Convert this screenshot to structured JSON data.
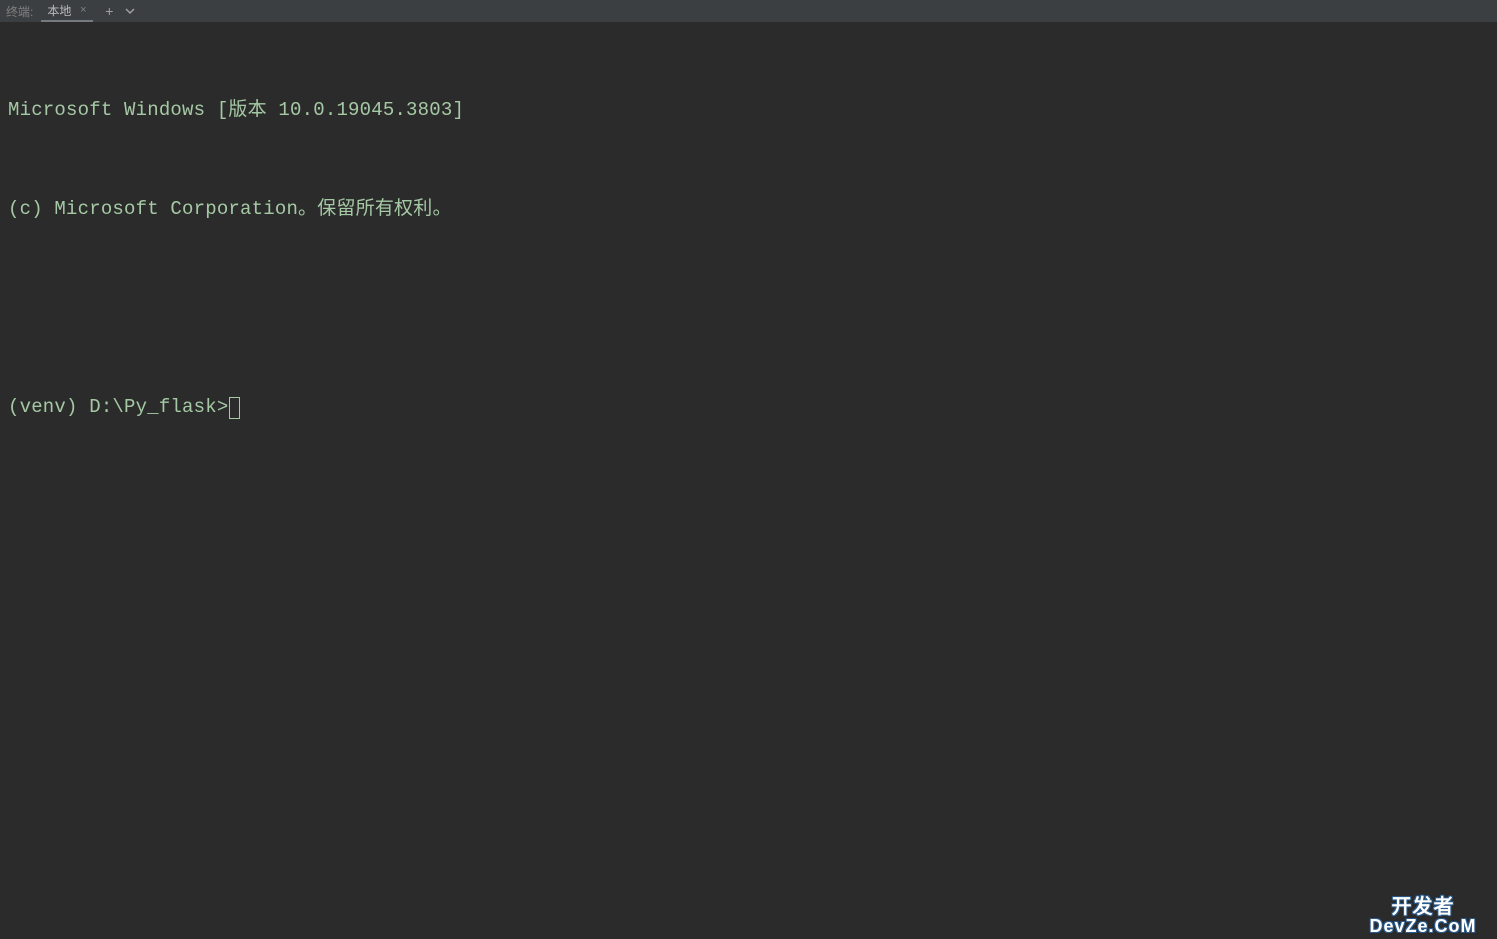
{
  "tabbar": {
    "label": "终端:",
    "tab_name": "本地",
    "add_label": "+",
    "dropdown_glyph": "⌄"
  },
  "terminal": {
    "line1": "Microsoft Windows [版本 10.0.19045.3803]",
    "line2": "(c) Microsoft Corporation。保留所有权利。",
    "blank": " ",
    "prompt": "(venv) D:\\Py_flask>"
  },
  "watermark": {
    "top": "开发者",
    "bottom": "DevZe.CoM"
  }
}
